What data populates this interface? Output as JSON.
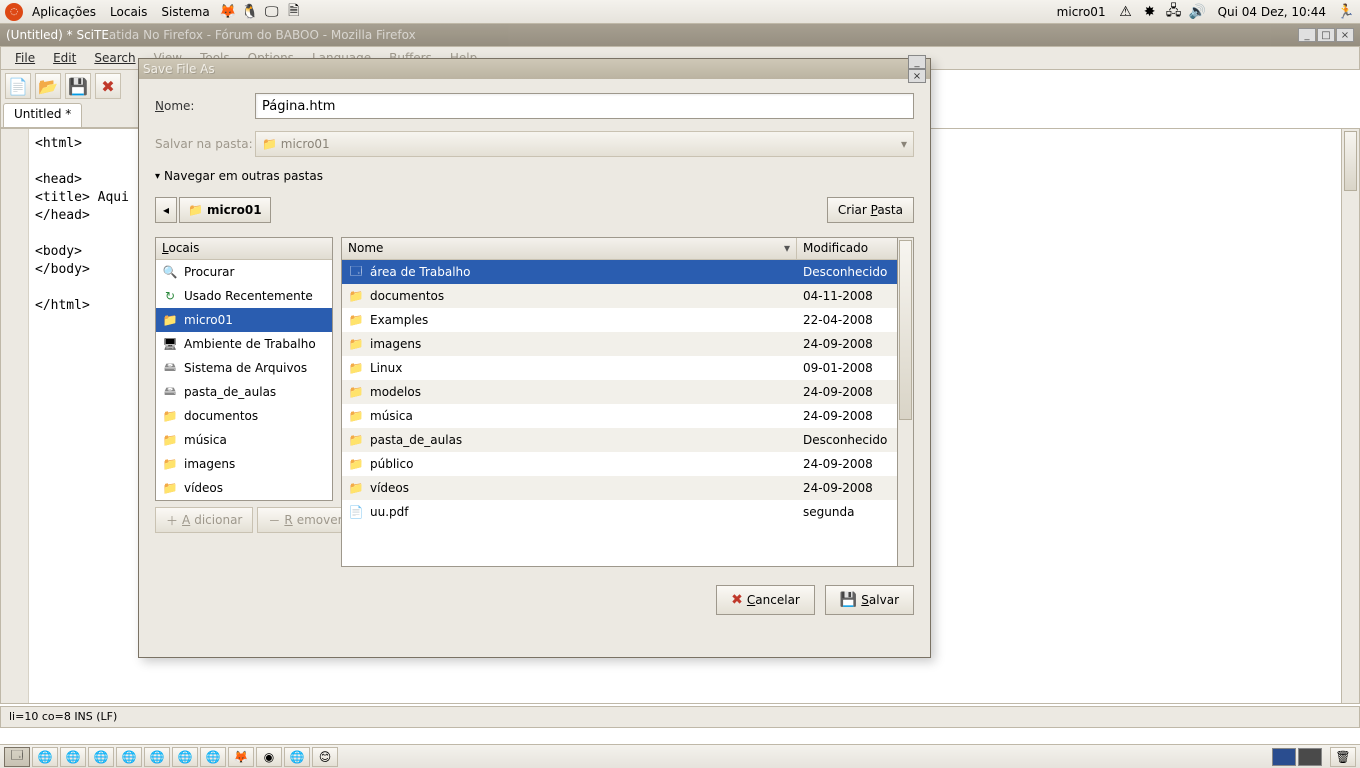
{
  "panel": {
    "menus": [
      "Aplicações",
      "Locais",
      "Sistema"
    ],
    "right_label": "micro01",
    "clock": "Qui 04 Dez, 10:44"
  },
  "bg_window": {
    "title": "(Untitled) * SciTE",
    "title_faded": "  atida No Firefox - Fórum do BABOO - Mozilla Firefox"
  },
  "editor": {
    "menus": [
      "File",
      "Edit",
      "Search",
      "View",
      "Tools",
      "Options",
      "Language",
      "Buffers",
      "Help"
    ],
    "tab": "Untitled *",
    "content": "<html>\n\n<head>\n<title> Aqui fica\n</head>\n\n<body>\n</body>\n\n</html>",
    "status": "li=10 co=8 INS (LF)"
  },
  "dialog": {
    "title": "Save File As",
    "name_label": "Nome:",
    "name_value": "Página.htm",
    "folder_label": "Salvar na pasta:",
    "folder_value": "micro01",
    "expander": "Navegar em outras pastas",
    "path_segment": "micro01",
    "create_folder": "Criar Pasta",
    "places_header": "Locais",
    "places": [
      {
        "icon": "🔍",
        "label": "Procurar",
        "cls": "ficon-search"
      },
      {
        "icon": "↻",
        "label": "Usado Recentemente",
        "cls": "ficon-recent"
      },
      {
        "icon": "📁",
        "label": "micro01",
        "cls": "ficon-folder",
        "selected": true
      },
      {
        "icon": "🖥",
        "label": "Ambiente de Trabalho",
        "cls": ""
      },
      {
        "icon": "🖴",
        "label": "Sistema de Arquivos",
        "cls": "ficon-drive"
      },
      {
        "icon": "🖴",
        "label": "pasta_de_aulas",
        "cls": "ficon-drive"
      },
      {
        "icon": "📁",
        "label": "documentos",
        "cls": "ficon-folder"
      },
      {
        "icon": "📁",
        "label": "música",
        "cls": "ficon-folder"
      },
      {
        "icon": "📁",
        "label": "imagens",
        "cls": "ficon-folder"
      },
      {
        "icon": "📁",
        "label": "vídeos",
        "cls": "ficon-folder"
      }
    ],
    "add_btn": "Adicionar",
    "remove_btn": "Remover",
    "col_name": "Nome",
    "col_mod": "Modificado",
    "files": [
      {
        "icon": "🗔",
        "name": "área de Trabalho",
        "mod": "Desconhecido",
        "selected": true,
        "cls": "ficon-desktop"
      },
      {
        "icon": "📁",
        "name": "documentos",
        "mod": "04-11-2008",
        "cls": "ficon-folder"
      },
      {
        "icon": "📁",
        "name": "Examples",
        "mod": "22-04-2008",
        "cls": "ficon-folder"
      },
      {
        "icon": "📁",
        "name": "imagens",
        "mod": "24-09-2008",
        "cls": "ficon-folder"
      },
      {
        "icon": "📁",
        "name": "Linux",
        "mod": "09-01-2008",
        "cls": "ficon-folder"
      },
      {
        "icon": "📁",
        "name": "modelos",
        "mod": "24-09-2008",
        "cls": "ficon-folder"
      },
      {
        "icon": "📁",
        "name": "música",
        "mod": "24-09-2008",
        "cls": "ficon-folder"
      },
      {
        "icon": "📁",
        "name": "pasta_de_aulas",
        "mod": "Desconhecido",
        "cls": "ficon-folder"
      },
      {
        "icon": "📁",
        "name": "público",
        "mod": "24-09-2008",
        "cls": "ficon-folder"
      },
      {
        "icon": "📁",
        "name": "vídeos",
        "mod": "24-09-2008",
        "cls": "ficon-folder"
      },
      {
        "icon": "📄",
        "name": "uu.pdf",
        "mod": "segunda",
        "cls": ""
      }
    ],
    "cancel": "Cancelar",
    "save": "Salvar"
  }
}
